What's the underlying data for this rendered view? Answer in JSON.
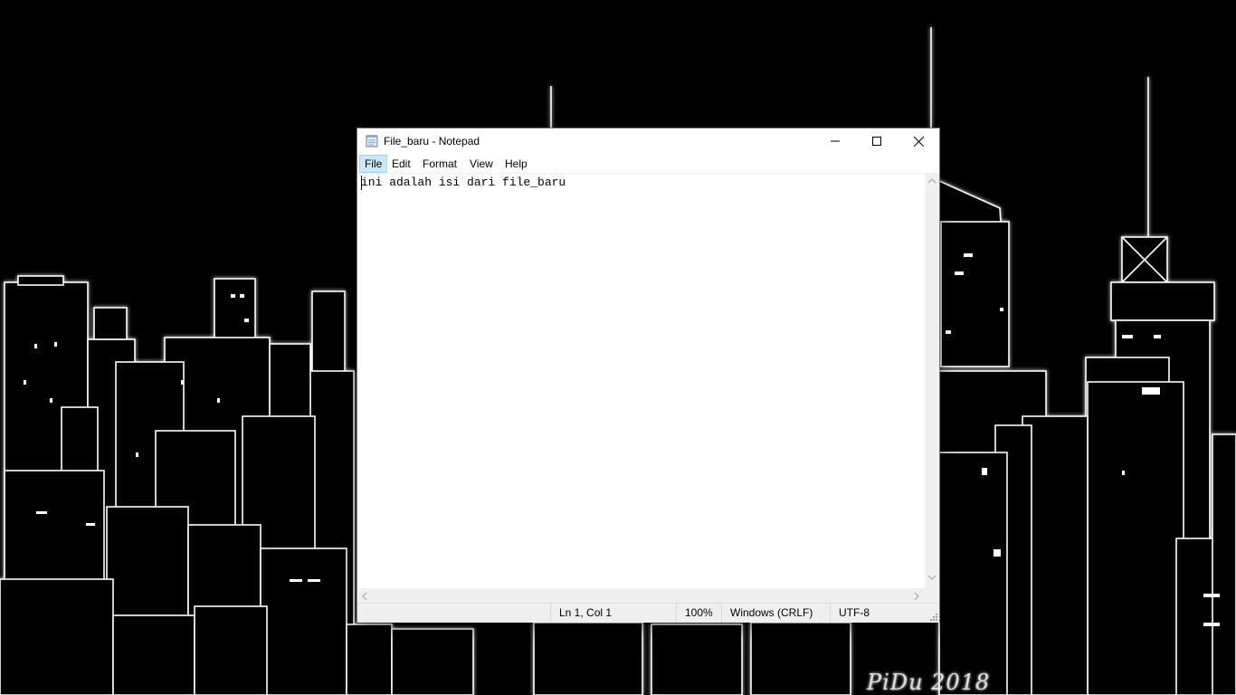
{
  "wallpaper": {
    "signature": "PiDu 2018"
  },
  "window": {
    "title": "File_baru - Notepad",
    "icon": "notepad-icon",
    "controls": {
      "minimize": "minimize-icon",
      "maximize": "maximize-icon",
      "close": "close-icon"
    }
  },
  "menu": {
    "items": [
      {
        "label": "File"
      },
      {
        "label": "Edit"
      },
      {
        "label": "Format"
      },
      {
        "label": "View"
      },
      {
        "label": "Help"
      }
    ],
    "active": "File"
  },
  "editor": {
    "content": "ini adalah isi dari file_baru"
  },
  "status": {
    "position": "Ln 1, Col 1",
    "zoom": "100%",
    "line_ending": "Windows (CRLF)",
    "encoding": "UTF-8"
  },
  "colors": {
    "menu_highlight": "#cce8ff",
    "statusbar": "#f0f0f0"
  }
}
